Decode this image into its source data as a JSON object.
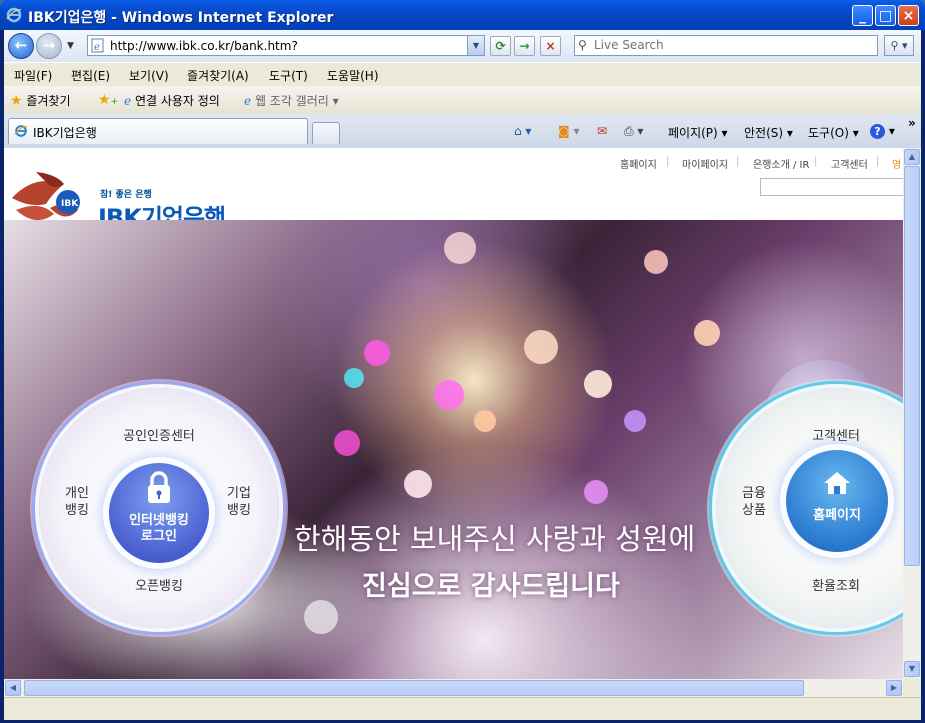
{
  "window": {
    "title": "IBK기업은행 - Windows Internet Explorer",
    "controls": {
      "minimize": "_",
      "maximize": "□",
      "close": "×"
    }
  },
  "address_bar": {
    "url": "http://www.ibk.co.kr/bank.htm?",
    "search_placeholder": "Live Search"
  },
  "menu": [
    "파일(F)",
    "편집(E)",
    "보기(V)",
    "즐겨찾기(A)",
    "도구(T)",
    "도움말(H)"
  ],
  "favorites_bar": {
    "favorites_label": "즐겨찾기",
    "items": [
      {
        "label": "연결 사용자 정의",
        "icon": "ie-page-icon"
      },
      {
        "label": "웹 조각 갤러리 ▾",
        "icon": "ie-page-icon"
      }
    ]
  },
  "tabs": [
    {
      "label": "IBK기업은행",
      "active": true
    }
  ],
  "command_bar": {
    "page": "페이지(P)",
    "safety": "안전(S)",
    "tools": "도구(O)",
    "help": "?",
    "more": "»"
  },
  "site": {
    "top_links": [
      "홈페이지",
      "마이페이지",
      "은행소개 / IR",
      "고객센터",
      "영"
    ],
    "logo": {
      "tagline": "참! 좋은 은행",
      "name": "IBK기업은행"
    },
    "slogan_line1": "한해동안 보내주신 사랑과 성원에",
    "slogan_line2": "진심으로 감사드립니다",
    "left_wheel": {
      "top": "공인인증센터",
      "left": "개인\n뱅킹",
      "right": "기업\n뱅킹",
      "bottom": "오픈뱅킹",
      "center": "인터넷뱅킹\n로그인",
      "center_icon": "lock-icon"
    },
    "right_wheel": {
      "top": "고객센터",
      "left": "금융\n상품",
      "bottom": "환율조회",
      "center": "홈페이지",
      "center_icon": "house-icon"
    }
  },
  "colors": {
    "title_bar": "#0848c8",
    "brand_blue": "#0a58b8",
    "wheel_accent": "#4a60d0"
  }
}
